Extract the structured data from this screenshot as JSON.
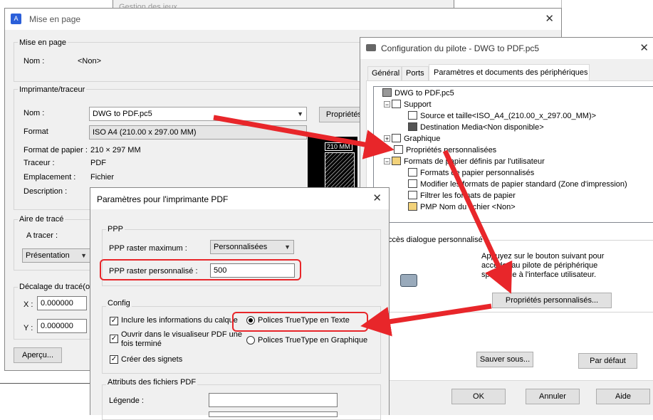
{
  "back_window": {
    "title_fragment": "Gestion des jeux"
  },
  "mise_en_page": {
    "title": "Mise en page",
    "group_mise": "Mise en page",
    "nom_label": "Nom :",
    "nom_value": "<Non>",
    "group_imprimante": "Imprimante/traceur",
    "imp_nom_label": "Nom :",
    "imp_nom_value": "DWG to PDF.pc5",
    "proprietes_btn": "Propriétés",
    "format_label": "Format",
    "format_value": "ISO A4 (210.00 x 297.00 MM)",
    "format_papier_label": "Format de papier :",
    "format_papier_value": "210 × 297  MM",
    "traceur_label": "Traceur :",
    "traceur_value": "PDF",
    "emplacement_label": "Emplacement :",
    "emplacement_value": "Fichier",
    "description_label": "Description :",
    "preview_label": "210 MM",
    "group_aire": "Aire de tracé",
    "a_tracer_label": "A tracer :",
    "a_tracer_value": "Présentation",
    "group_decalage": "Décalage du tracé(or",
    "x_label": "X :",
    "x_value": "0.000000",
    "y_label": "Y :",
    "y_value": "0.000000",
    "apercu_btn": "Aperçu..."
  },
  "config_pilote": {
    "title": "Configuration du pilote - DWG to PDF.pc5",
    "tabs": [
      "Général",
      "Ports",
      "Paramètres et documents des périphériques"
    ],
    "tree": [
      "DWG to PDF.pc5",
      "Support",
      "Source et taille<ISO_A4_(210.00_x_297.00_MM)>",
      "Destination Media<Non disponible>",
      "Graphique",
      "Propriétés personnalisées",
      "Formats de papier définis par l'utilisateur",
      "Formats de papier personnalisés",
      "Modifier les formats de papier standard (Zone d'impression)",
      "Filtrer les formats de papier",
      "PMP Nom du fichier <Non>"
    ],
    "group_acces": "ccès dialogue personnalisé",
    "help_text_1": "Appuyez sur le bouton suivant pour",
    "help_text_2": "accéder au pilote de périphérique",
    "help_text_3": "spécifique à l'interface utilisateur.",
    "proprietes_perso_btn": "Propriétés personnalisés...",
    "sauver_btn": "Sauver sous...",
    "par_defaut_btn": "Par défaut",
    "ok_btn": "OK",
    "annuler_btn": "Annuler",
    "aide_btn": "Aide"
  },
  "pdf_params": {
    "title": "Paramètres pour l'imprimante PDF",
    "group_ppp": "PPP",
    "ppp_max_label": "PPP raster maximum :",
    "ppp_max_value": "Personnalisées",
    "ppp_perso_label": "PPP raster personnalisé :",
    "ppp_perso_value": "500",
    "group_config": "Config",
    "chk_calque": "Inclure les informations du calque",
    "chk_visualiseur_1": "Ouvrir dans le visualiseur PDF une",
    "chk_visualiseur_2": "fois terminé",
    "chk_signets": "Créer des signets",
    "radio_texte": "Polices TrueType en Texte",
    "radio_graphique": "Polices TrueType en Graphique",
    "group_attributs": "Attributs des fichiers PDF",
    "legende_label": "Légende :"
  },
  "colors": {
    "annotation_red": "#e8262a",
    "accent_blue": "#1e5fd8"
  }
}
